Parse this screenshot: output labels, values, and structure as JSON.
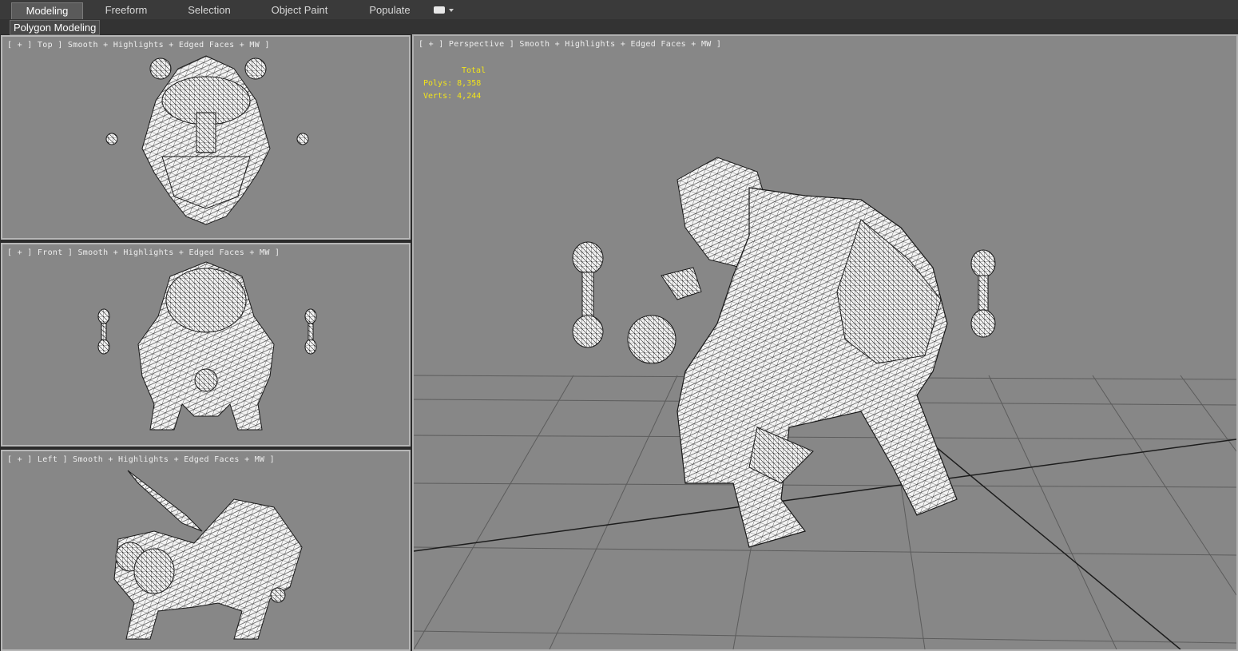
{
  "ribbon": {
    "tabs": [
      {
        "label": "Modeling",
        "active": true
      },
      {
        "label": "Freeform",
        "active": false
      },
      {
        "label": "Selection",
        "active": false
      },
      {
        "label": "Object Paint",
        "active": false
      },
      {
        "label": "Populate",
        "active": false
      }
    ],
    "panel_label": "Polygon Modeling"
  },
  "viewports": {
    "top": {
      "label": "[ + ] Top ] Smooth + Highlights + Edged Faces + MW ]"
    },
    "front": {
      "label": "[ + ] Front ] Smooth + Highlights + Edged Faces + MW ]"
    },
    "left": {
      "label": "[ + ] Left ] Smooth + Highlights + Edged Faces + MW ]"
    },
    "perspective": {
      "label": "[ + ] Perspective ] Smooth + Highlights + Edged Faces + MW ]"
    }
  },
  "stats": {
    "header": "Total",
    "polys_label": "Polys:",
    "polys_value": "8,358",
    "verts_label": "Verts:",
    "verts_value": "4,244"
  },
  "colors": {
    "viewport_bg": "#878787",
    "stats_text": "#f2e41a",
    "grid_line": "#5a5a5a",
    "mesh_fill": "#f4f4f4",
    "mesh_wire": "#1a1a1a"
  }
}
